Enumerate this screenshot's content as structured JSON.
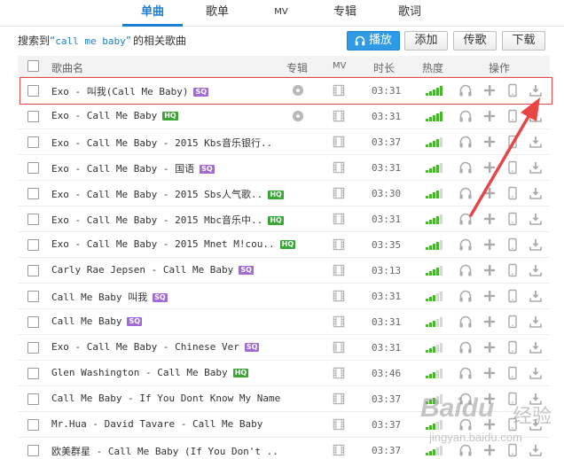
{
  "tabs": [
    {
      "label": "单曲",
      "active": true
    },
    {
      "label": "歌单",
      "active": false
    },
    {
      "label": "MV",
      "active": false
    },
    {
      "label": "专辑",
      "active": false
    },
    {
      "label": "歌词",
      "active": false
    }
  ],
  "search": {
    "prefix": "搜索到",
    "quote_open": "“",
    "keyword": "call me baby",
    "quote_close": "”",
    "suffix": "的相关歌曲"
  },
  "actions": {
    "play": "播放",
    "add": "添加",
    "upload": "传歌",
    "download": "下载"
  },
  "columns": {
    "song": "歌曲名",
    "album": "专辑",
    "mv": "MV",
    "duration": "时长",
    "heat": "热度",
    "ops": "操作"
  },
  "songs": [
    {
      "title": "Exo - 叫我(Call Me Baby)",
      "badge": "SQ",
      "album": true,
      "duration": "03:31",
      "heat_level": 5
    },
    {
      "title": "Exo - Call Me Baby",
      "badge": "HQ",
      "album": true,
      "duration": "03:31",
      "heat_level": 5
    },
    {
      "title": "Exo - Call Me Baby - 2015 Kbs音乐银行..",
      "badge": "",
      "album": false,
      "duration": "03:37",
      "heat_level": 4
    },
    {
      "title": "Exo - Call Me Baby - 国语",
      "badge": "SQ",
      "album": false,
      "duration": "03:31",
      "heat_level": 4
    },
    {
      "title": "Exo - Call Me Baby - 2015 Sbs人气歌..",
      "badge": "HQ",
      "album": false,
      "duration": "03:30",
      "heat_level": 4
    },
    {
      "title": "Exo - Call Me Baby - 2015 Mbc音乐中..",
      "badge": "HQ",
      "album": false,
      "duration": "03:31",
      "heat_level": 4
    },
    {
      "title": "Exo - Call Me Baby - 2015 Mnet M!cou..",
      "badge": "HQ",
      "album": false,
      "duration": "03:35",
      "heat_level": 4
    },
    {
      "title": "Carly Rae Jepsen - Call Me Baby",
      "badge": "SQ",
      "album": false,
      "duration": "03:13",
      "heat_level": 4
    },
    {
      "title": "Call Me Baby 叫我",
      "badge": "SQ",
      "album": false,
      "duration": "03:31",
      "heat_level": 3
    },
    {
      "title": "Call Me Baby",
      "badge": "SQ",
      "album": false,
      "duration": "03:31",
      "heat_level": 3
    },
    {
      "title": "Exo - Call Me Baby - Chinese Ver",
      "badge": "SQ",
      "album": false,
      "duration": "03:31",
      "heat_level": 3
    },
    {
      "title": "Glen Washington - Call Me Baby",
      "badge": "HQ",
      "album": false,
      "duration": "03:46",
      "heat_level": 3
    },
    {
      "title": "Call Me Baby - If You Dont Know My Name",
      "badge": "",
      "album": false,
      "duration": "03:37",
      "heat_level": 3
    },
    {
      "title": "Mr.Hua - David Tavare - Call Me Baby",
      "badge": "",
      "album": false,
      "duration": "03:37",
      "heat_level": 3
    },
    {
      "title": "欧美群星 - Call Me Baby (If You Don't ..",
      "badge": "",
      "album": false,
      "duration": "03:37",
      "heat_level": 3
    }
  ],
  "row_icons": [
    "headphones-icon",
    "plus-icon",
    "phone-icon",
    "download-icon"
  ],
  "colors": {
    "accent": "#1a7fd6",
    "heat": "#47b62c",
    "highlight": "#e84545",
    "sq": "#a26ad6",
    "hq": "#3aa635"
  },
  "watermark": {
    "brand": "Baidu",
    "sub": "经验",
    "url": "jingyan.baidu.com"
  }
}
